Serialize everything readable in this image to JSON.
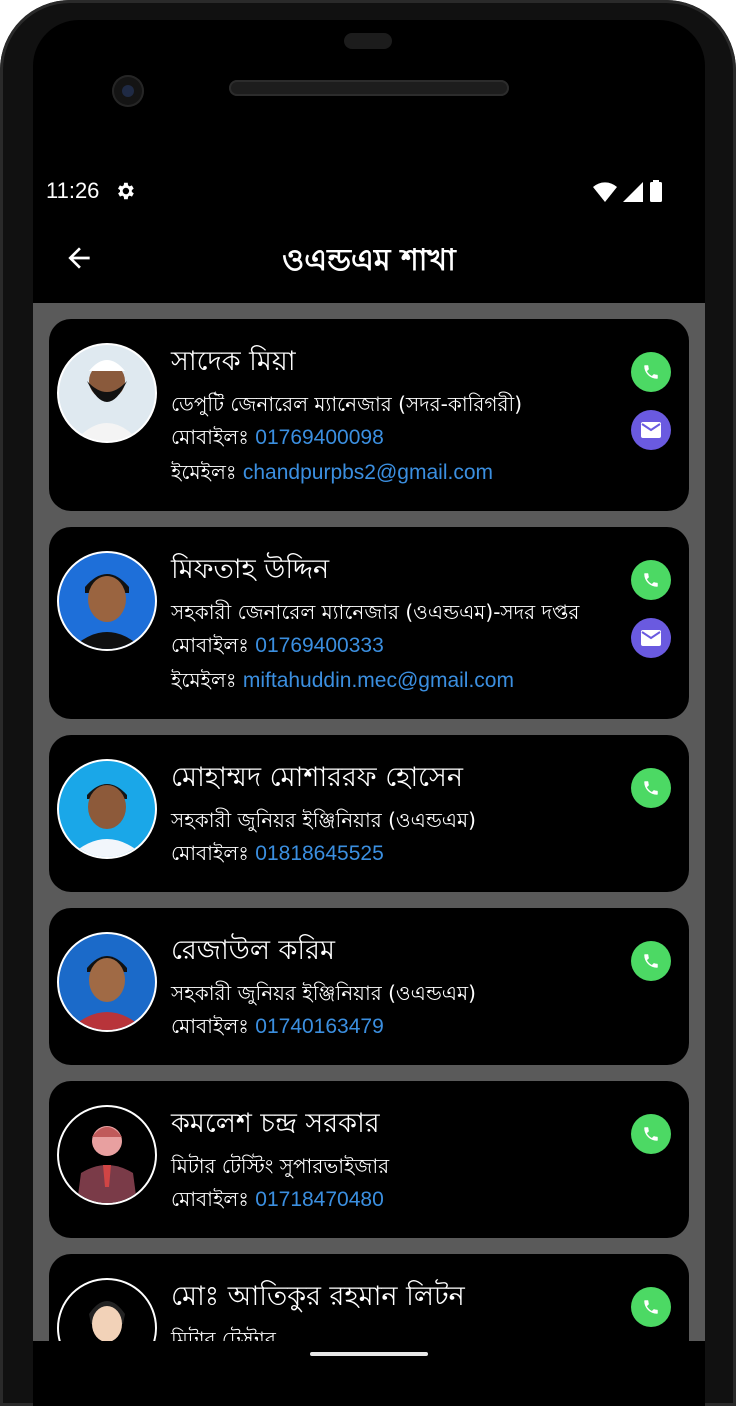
{
  "status_bar": {
    "time": "11:26"
  },
  "app_bar": {
    "title": "ওএন্ডএম শাখা",
    "back_icon": "arrow-left-icon"
  },
  "labels": {
    "mobile_prefix": "মোবাইলঃ ",
    "email_prefix": "ইমেইলঃ "
  },
  "colors": {
    "call": "#4cd964",
    "mail": "#6a5ae0",
    "link": "#3b8fe0",
    "list_bg": "#5a5a5a"
  },
  "contacts": [
    {
      "name": "সাদেক মিয়া",
      "designation": "ডেপুটি জেনারেল ম্যানেজার (সদর-কারিগরী)",
      "mobile": "01769400098",
      "email": "chandpurpbs2@gmail.com"
    },
    {
      "name": "মিফতাহ উদ্দিন",
      "designation": "সহকারী জেনারেল ম্যানেজার (ওএন্ডএম)-সদর দপ্তর",
      "mobile": "01769400333",
      "email": "miftahuddin.mec@gmail.com"
    },
    {
      "name": "মোহাম্মদ মোশাররফ হোসেন",
      "designation": "সহকারী জুনিয়র ইঞ্জিনিয়ার (ওএন্ডএম)",
      "mobile": "01818645525"
    },
    {
      "name": "রেজাউল করিম",
      "designation": "সহকারী জুনিয়র ইঞ্জিনিয়ার (ওএন্ডএম)",
      "mobile": "01740163479"
    },
    {
      "name": "কমলেশ চন্দ্র সরকার",
      "designation": "মিটার টেস্টিং সুপারভাইজার",
      "mobile": "01718470480"
    },
    {
      "name": "মোঃ আতিকুর রহমান লিটন",
      "designation": "মিটার টেস্টার"
    }
  ]
}
